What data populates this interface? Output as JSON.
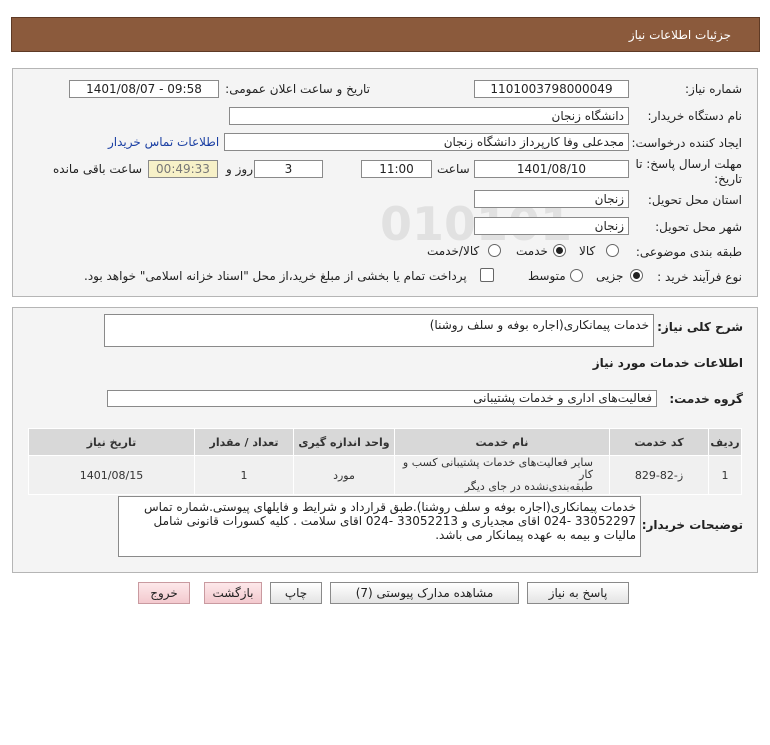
{
  "header": {
    "title": "جزئیات اطلاعات نیاز"
  },
  "fields": {
    "need_number_label": "شماره نیاز:",
    "need_number": "1101003798000049",
    "announce_label": "تاریخ و ساعت اعلان عمومی:",
    "announce_value": "1401/08/07 - 09:58",
    "buyer_org_label": "نام دستگاه خریدار:",
    "buyer_org": "دانشگاه زنجان",
    "creator_label": "ایجاد کننده درخواست:",
    "creator": "مجدعلی وفا کارپرداز دانشگاه زنجان",
    "contact_link": "اطلاعات تماس خریدار",
    "deadline_label_line1": "مهلت ارسال پاسخ: تا",
    "deadline_label_line2": "تاریخ:",
    "deadline_date": "1401/08/10",
    "time_label": "ساعت",
    "deadline_time": "11:00",
    "days_value": "3",
    "days_label": "روز و",
    "remaining_time": "00:49:33",
    "remaining_label": "ساعت باقی مانده",
    "province_label": "استان محل تحویل:",
    "province": "زنجان",
    "city_label": "شهر محل تحویل:",
    "city": "زنجان",
    "category_label": "طبقه بندی موضوعی:",
    "category_options": [
      "کالا",
      "خدمت",
      "کالا/خدمت"
    ],
    "category_selected": "خدمت",
    "process_label": "نوع فرآیند خرید :",
    "process_options": [
      "جزیی",
      "متوسط"
    ],
    "process_selected": "جزیی",
    "payment_note": "پرداخت تمام یا بخشی از مبلغ خرید،از محل \"اسناد خزانه اسلامی\" خواهد بود."
  },
  "summary": {
    "label": "شرح کلی نیاز:",
    "value": "خدمات پیمانکاری(اجاره بوفه و سلف روشنا)"
  },
  "services_header": "اطلاعات خدمات مورد نیاز",
  "service_group": {
    "label": "گروه خدمت:",
    "value": "فعالیت‌های اداری و خدمات پشتیبانی"
  },
  "table": {
    "headers": [
      "ردیف",
      "کد خدمت",
      "نام خدمت",
      "واحد اندازه گیری",
      "تعداد / مقدار",
      "تاریخ نیاز"
    ],
    "rows": [
      {
        "row": "1",
        "code": "ز-82-829",
        "name_line1": "سایر فعالیت‌های خدمات پشتیبانی کسب و کار",
        "name_line2": "طبقه‌بندی‌نشده در جای دیگر",
        "unit": "مورد",
        "qty": "1",
        "date": "1401/08/15"
      }
    ]
  },
  "buyer_notes": {
    "label": "توضیحات خریدار:",
    "value": "خدمات پیمانکاری(اجاره بوفه و سلف روشنا).طبق قرارداد و شرایط و فایلهای پیوستی.شماره تماس 33052297 -024 اقای مجدیاری و 33052213 -024 اقای سلامت . کلیه کسورات قانونی شامل مالیات و بیمه به عهده پیمانکار می باشد."
  },
  "buttons": {
    "reply": "پاسخ به نیاز",
    "docs": "مشاهده مدارک پیوستی (7)",
    "print": "چاپ",
    "back": "بازگشت",
    "exit": "خروج"
  }
}
